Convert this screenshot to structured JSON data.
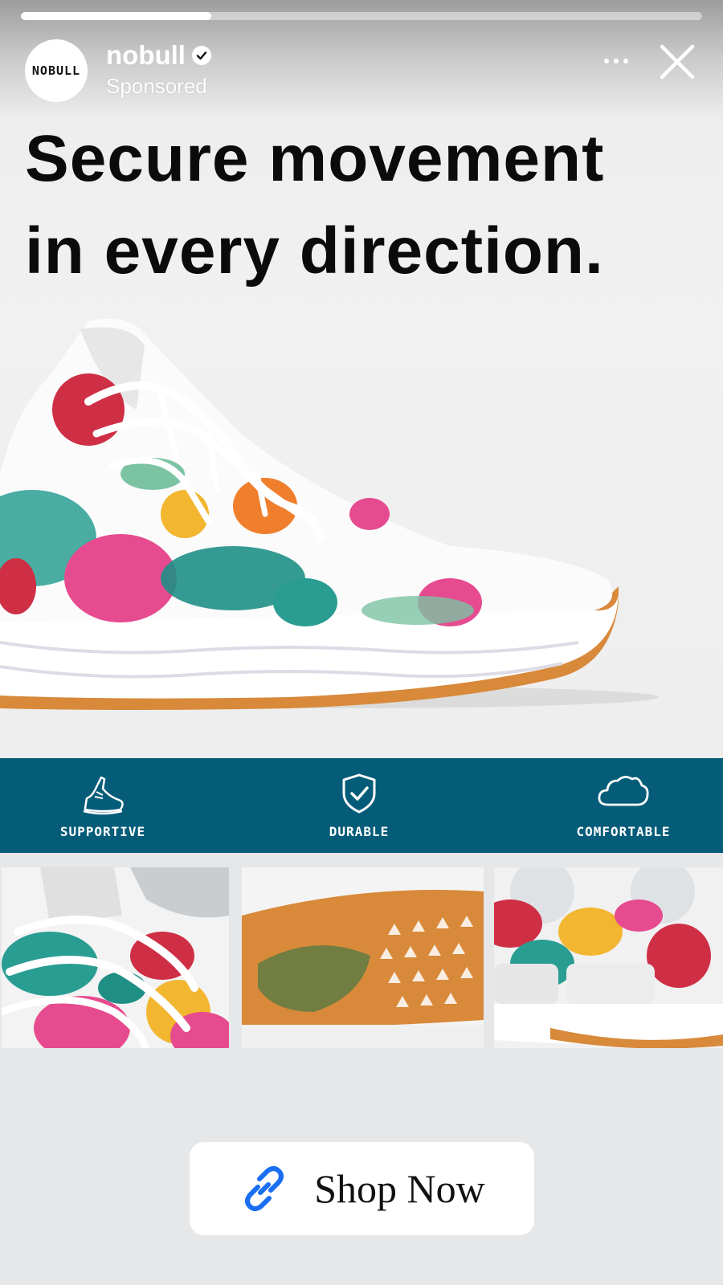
{
  "story": {
    "progress_fraction": 0.28,
    "brand_logo_text": "NOBULL",
    "username": "nobull",
    "sponsored_label": "Sponsored",
    "headline_line1": "Secure movement",
    "headline_line2": "in every direction."
  },
  "features": [
    {
      "label": "SUPPORTIVE",
      "icon": "sneaker-icon"
    },
    {
      "label": "DURABLE",
      "icon": "shield-check-icon"
    },
    {
      "label": "COMFORTABLE",
      "icon": "cloud-icon"
    }
  ],
  "thumbnails": [
    "shoe-laces-closeup",
    "shoe-outsole",
    "shoe-heel"
  ],
  "cta": {
    "label": "Shop Now",
    "icon": "link-icon"
  },
  "colors": {
    "feature_bar": "#045c78",
    "link_icon": "#1a6ef2",
    "background": "#e6e7e9",
    "gum_sole": "#d8893a"
  }
}
